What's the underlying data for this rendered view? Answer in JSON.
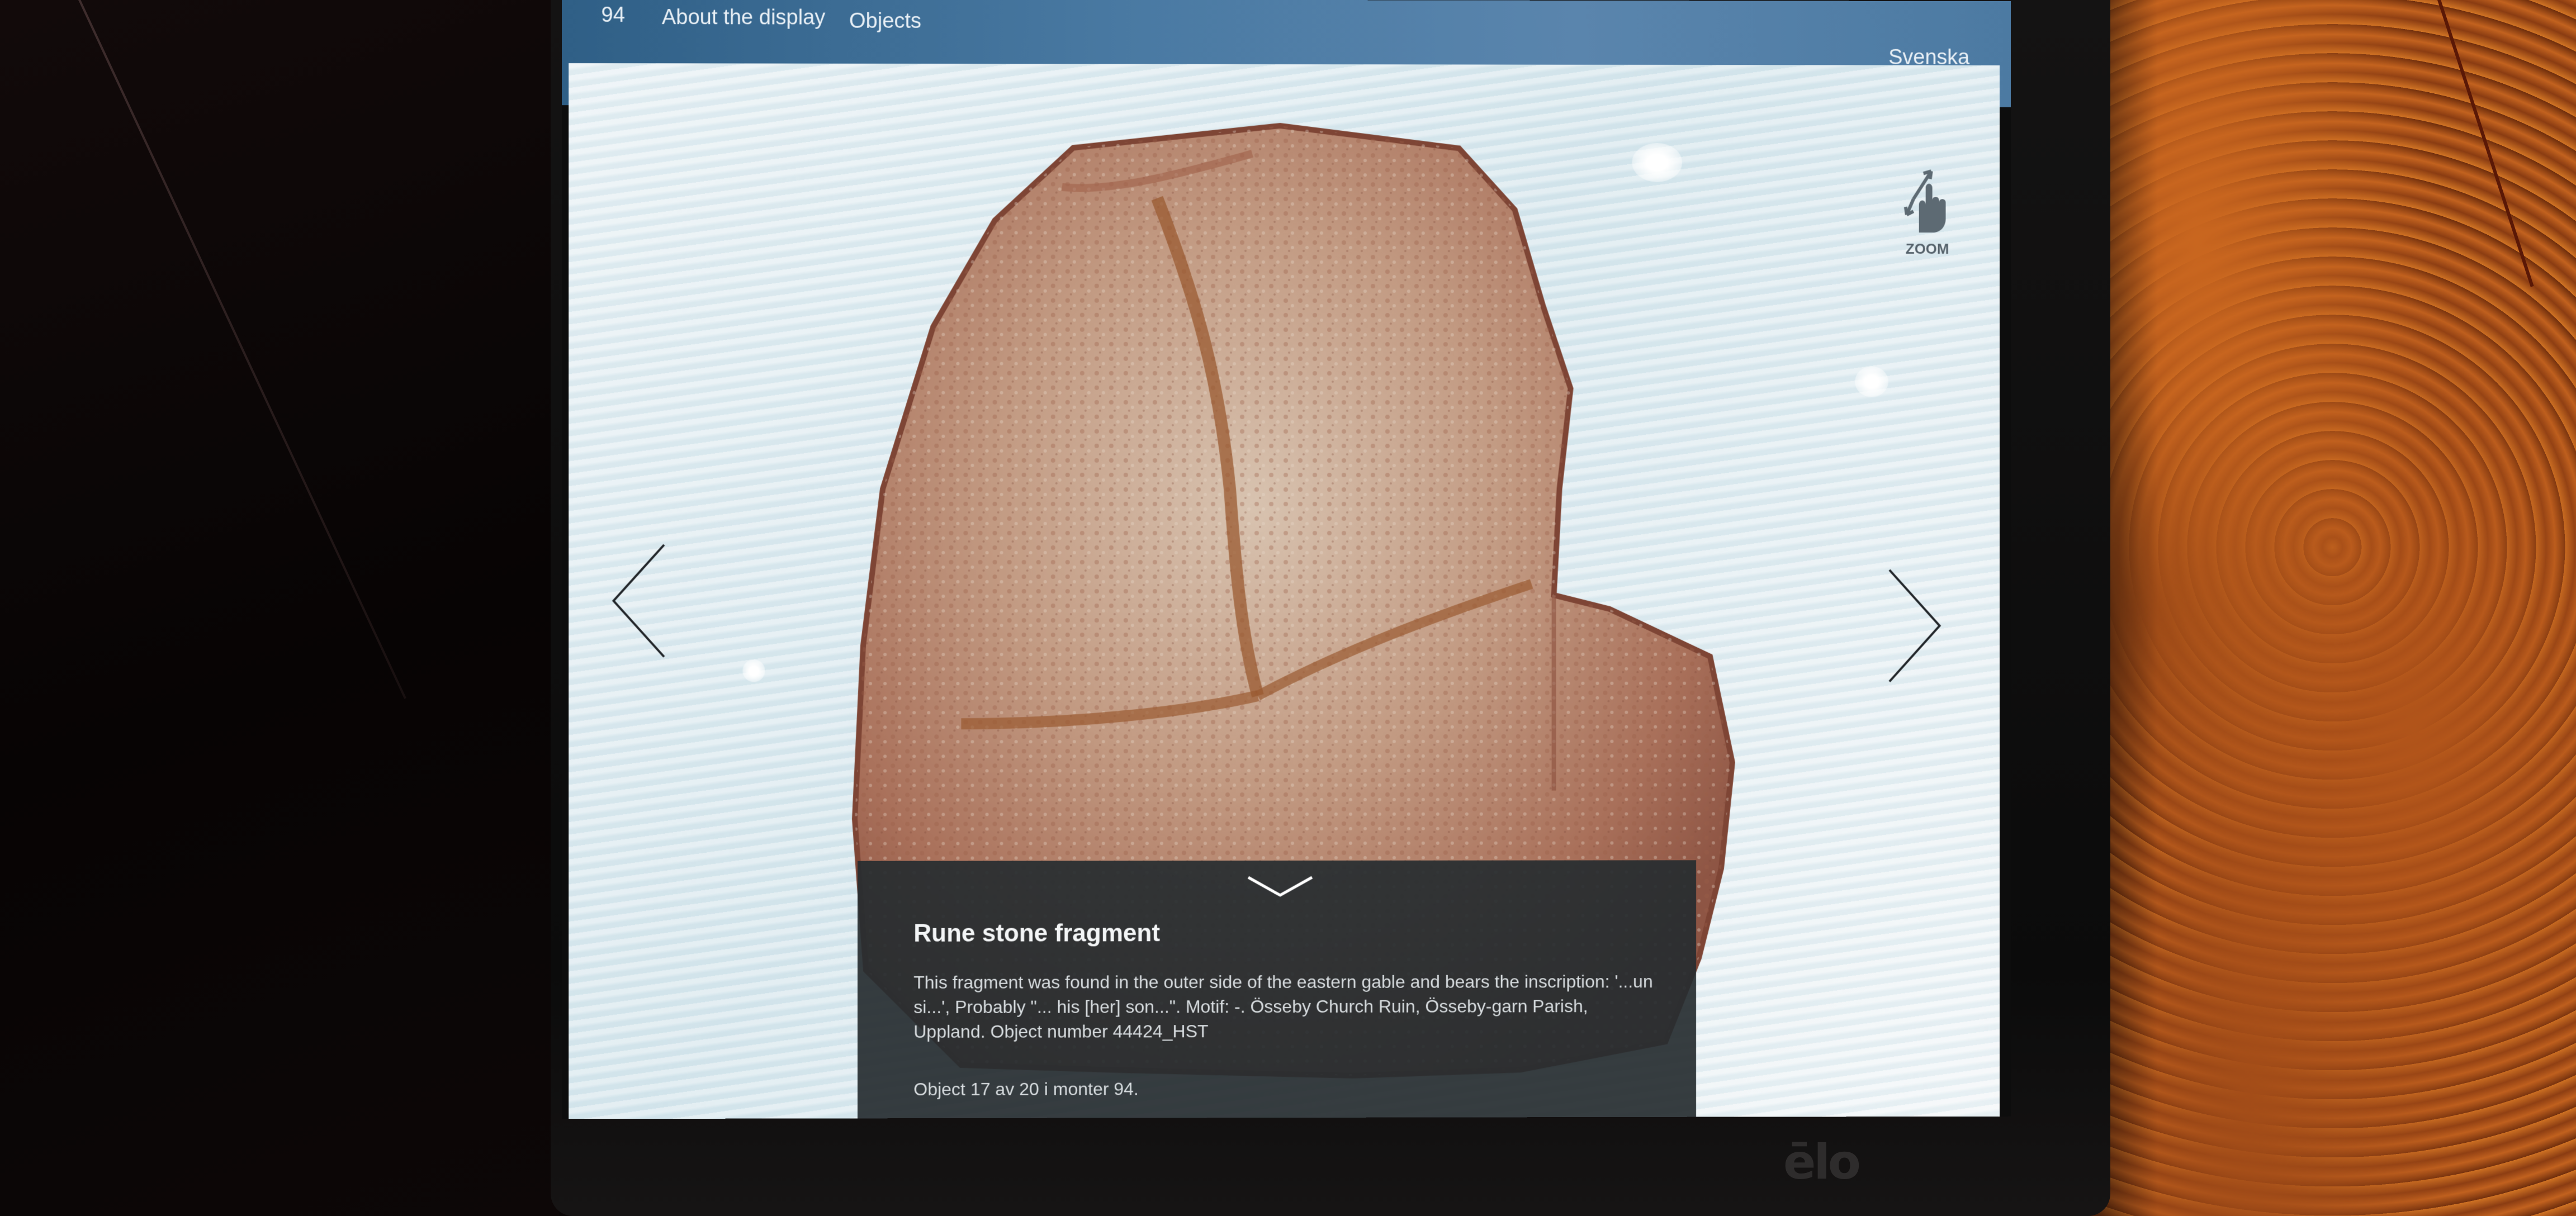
{
  "top_bar": {
    "monter_number": "94",
    "about_label": "About the display",
    "objects_label": "Objects",
    "language_label": "Svenska"
  },
  "viewer": {
    "zoom_label": "ZOOM",
    "zoom_icon": "hand-pinch-zoom-icon",
    "prev_icon": "chevron-left-icon",
    "next_icon": "chevron-right-icon"
  },
  "info_panel": {
    "collapse_icon": "chevron-down-icon",
    "title": "Rune stone fragment",
    "description": "This fragment was found in the outer side of the eastern gable and bears the inscription: '...un si...', Probably \"... his [her] son...\". Motif: -. Össeby Church Ruin, Össeby-garn Parish, Uppland. Object number 44424_HST",
    "position": "Object 17 av 20 i monter 94."
  },
  "hardware": {
    "brand": "ēlo"
  },
  "colors": {
    "top_bar": "#3f6e97",
    "panel": "#262c30",
    "stone": "#b98a72",
    "rock_wall": "#b5571b"
  }
}
